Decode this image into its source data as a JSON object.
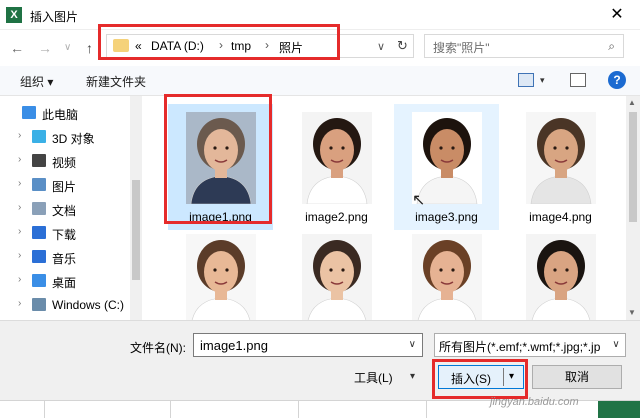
{
  "window": {
    "title": "插入图片",
    "app_icon": "X",
    "close": "✕"
  },
  "nav": {
    "back": "←",
    "forward": "→",
    "recent_dd": "∨",
    "up": "↑"
  },
  "address": {
    "prefix": "«",
    "crumbs": [
      "DATA (D:)",
      "tmp",
      "照片"
    ],
    "sep": "›",
    "dropdown": "∨",
    "refresh": "↻"
  },
  "search": {
    "placeholder": "搜索\"照片\"",
    "icon": "⌕"
  },
  "toolbar": {
    "organize": "组织 ▾",
    "new_folder": "新建文件夹",
    "view_dd": "▾",
    "help": "?"
  },
  "sidebar": {
    "items": [
      {
        "label": "此电脑",
        "icon": "computer-icon",
        "color": "#3a8ee6"
      },
      {
        "label": "3D 对象",
        "icon": "cube-icon",
        "color": "#3ab0e6"
      },
      {
        "label": "视频",
        "icon": "video-icon",
        "color": "#444444"
      },
      {
        "label": "图片",
        "icon": "picture-icon",
        "color": "#5a8fc6"
      },
      {
        "label": "文档",
        "icon": "document-icon",
        "color": "#8aa0b8"
      },
      {
        "label": "下载",
        "icon": "download-icon",
        "color": "#2b6fd6"
      },
      {
        "label": "音乐",
        "icon": "music-icon",
        "color": "#2b6fd6"
      },
      {
        "label": "桌面",
        "icon": "desktop-icon",
        "color": "#3a8ee6"
      },
      {
        "label": "Windows (C:)",
        "icon": "drive-icon",
        "color": "#6a8caa"
      }
    ],
    "expand_arrow": "›"
  },
  "files": [
    {
      "name": "image1.png",
      "skin": "#e3b79a",
      "hair": "#6b5a4e",
      "shirt": "#2d3a55",
      "bg": "#aab8c8"
    },
    {
      "name": "image2.png",
      "skin": "#d9a07f",
      "hair": "#241812",
      "shirt": "#ffffff",
      "bg": "#f4f4f4"
    },
    {
      "name": "image3.png",
      "skin": "#c98c66",
      "hair": "#1d130d",
      "shirt": "#f5f5f5",
      "bg": "#ffffff"
    },
    {
      "name": "image4.png",
      "skin": "#d8a582",
      "hair": "#4a3526",
      "shirt": "#e5e5e5",
      "bg": "#f6f6f6"
    },
    {
      "name": "",
      "skin": "#e8b896",
      "hair": "#5b3c29",
      "shirt": "#ffffff",
      "bg": "#f7f7f7"
    },
    {
      "name": "",
      "skin": "#ebc3a4",
      "hair": "#3a2a22",
      "shirt": "#ffffff",
      "bg": "#f4f4f4"
    },
    {
      "name": "",
      "skin": "#e6b293",
      "hair": "#6a4026",
      "shirt": "#ffffff",
      "bg": "#f6f6f6"
    },
    {
      "name": "",
      "skin": "#d9a482",
      "hair": "#1a1410",
      "shirt": "#ffffff",
      "bg": "#f4f4f4"
    }
  ],
  "footer": {
    "filename_label": "文件名(N):",
    "filename_value": "image1.png",
    "filename_dd": "∨",
    "filter_value": "所有图片(*.emf;*.wmf;*.jpg;*.jp",
    "filter_dd": "∨",
    "tools_label": "工具(L)",
    "tools_dd": "▾",
    "insert_label": "插入(S)",
    "insert_dd": "▾",
    "cancel_label": "取消"
  },
  "watermark": "jingyan.baidu.com",
  "colors": {
    "accent": "#0078d7",
    "highlight": "#e52b2b",
    "selection": "#cce8ff",
    "excel_green": "#217346"
  }
}
